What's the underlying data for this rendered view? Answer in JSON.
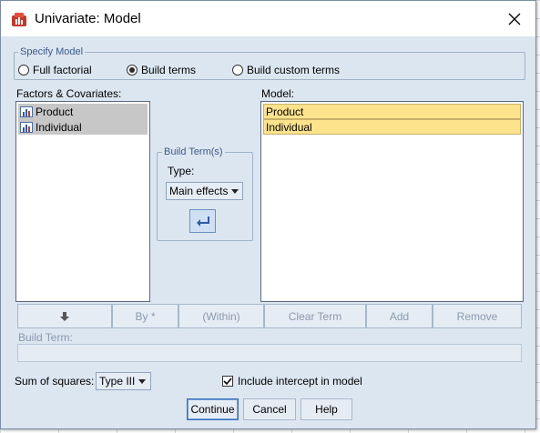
{
  "window": {
    "title": "Univariate: Model"
  },
  "specify_model": {
    "legend": "Specify Model",
    "options": [
      {
        "label": "Full factorial",
        "selected": false
      },
      {
        "label": "Build terms",
        "selected": true
      },
      {
        "label": "Build custom terms",
        "selected": false
      }
    ]
  },
  "factors": {
    "label": "Factors & Covariates:",
    "items": [
      "Product",
      "Individual"
    ]
  },
  "model": {
    "label": "Model:",
    "items": [
      "Product",
      "Individual"
    ]
  },
  "build_terms": {
    "legend": "Build Term(s)",
    "type_label": "Type:",
    "type_value": "Main effects"
  },
  "toolbar": {
    "by_label": "By *",
    "within_label": "(Within)",
    "clear_term_label": "Clear Term",
    "add_label": "Add",
    "remove_label": "Remove"
  },
  "build_term": {
    "label": "Build Term:",
    "value": ""
  },
  "sum_of_squares": {
    "label": "Sum of squares:",
    "value": "Type III"
  },
  "intercept": {
    "label": "Include intercept in model",
    "checked": true
  },
  "footer": {
    "continue_label": "Continue",
    "cancel_label": "Cancel",
    "help_label": "Help"
  },
  "colors": {
    "dialog_bg": "#dce6f0",
    "selected_item": "#fde38c",
    "accent": "#3c6eb4"
  }
}
